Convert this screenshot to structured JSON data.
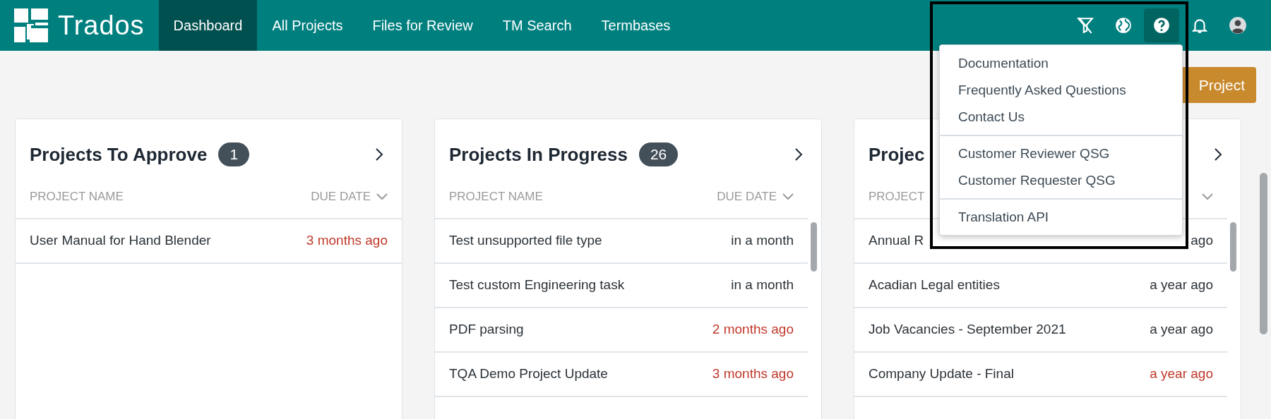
{
  "header": {
    "logo": "Trados",
    "tabs": [
      {
        "label": "Dashboard",
        "selected": true
      },
      {
        "label": "All Projects",
        "selected": false
      },
      {
        "label": "Files for Review",
        "selected": false
      },
      {
        "label": "TM Search",
        "selected": false
      },
      {
        "label": "Termbases",
        "selected": false
      }
    ],
    "icons": [
      {
        "kind": "filter",
        "selected": false
      },
      {
        "kind": "globe",
        "selected": false
      },
      {
        "kind": "help",
        "selected": true
      },
      {
        "kind": "bell",
        "selected": false
      },
      {
        "kind": "avatar",
        "selected": false
      }
    ]
  },
  "toolbar": {
    "new_project_button": "Project"
  },
  "help_menu": {
    "groups": [
      [
        "Documentation",
        "Frequently Asked Questions",
        "Contact Us"
      ],
      [
        "Customer Reviewer QSG",
        "Customer Requester QSG"
      ],
      [
        "Translation API"
      ]
    ]
  },
  "cards": [
    {
      "title": "Projects To Approve",
      "count": "1",
      "name_column": "PROJECT NAME",
      "due_column": "DUE DATE",
      "rows": [
        {
          "name": "User Manual for Hand Blender",
          "due": "3 months ago",
          "overdue": true
        }
      ]
    },
    {
      "title": "Projects In Progress",
      "count": "26",
      "name_column": "PROJECT NAME",
      "due_column": "DUE DATE",
      "rows": [
        {
          "name": "Test unsupported file type",
          "due": "in a month",
          "overdue": false
        },
        {
          "name": "Test custom Engineering task",
          "due": "in a month",
          "overdue": false
        },
        {
          "name": "PDF parsing",
          "due": "2 months ago",
          "overdue": true
        },
        {
          "name": "TQA Demo Project Update",
          "due": "3 months ago",
          "overdue": true
        }
      ]
    },
    {
      "title": "Projec",
      "name_column": "PROJECT",
      "rows": [
        {
          "name": "Annual R",
          "due": "ago",
          "overdue": false
        },
        {
          "name": "Acadian Legal entities",
          "due": "a year ago",
          "overdue": false
        },
        {
          "name": "Job Vacancies - September 2021",
          "due": "a year ago",
          "overdue": false
        },
        {
          "name": "Company Update - Final",
          "due": "a year ago",
          "overdue": true
        }
      ]
    }
  ]
}
